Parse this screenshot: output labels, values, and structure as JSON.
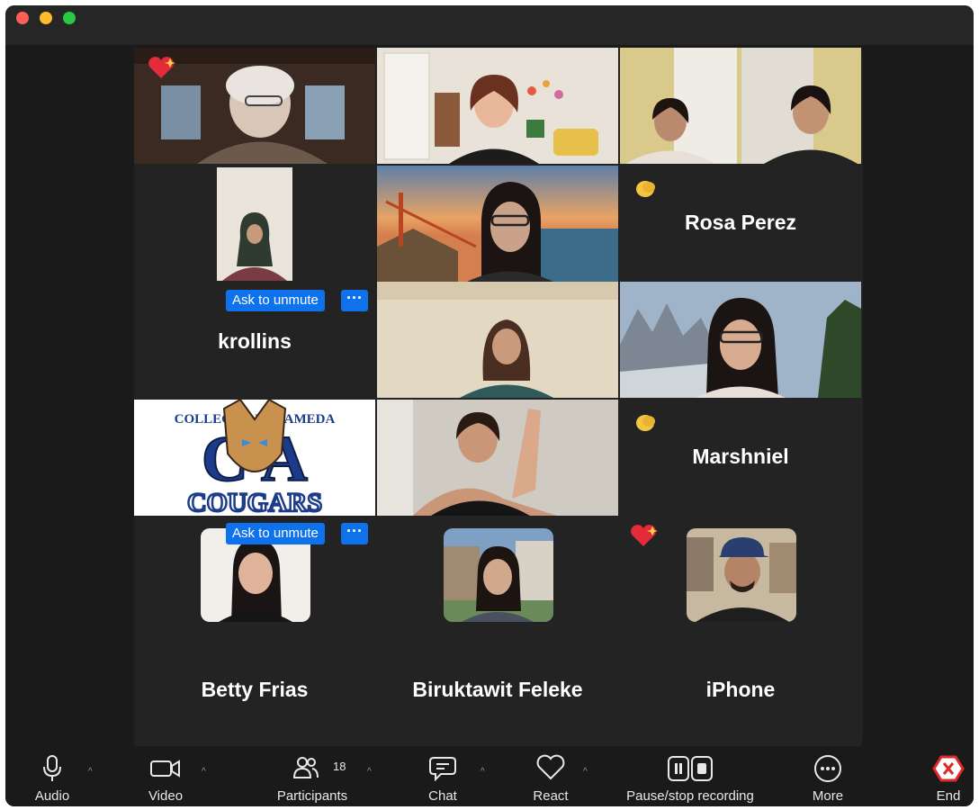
{
  "window": {
    "traffic_lights": {
      "close": "#ff5f57",
      "minimize": "#febc2e",
      "zoom": "#28c840"
    }
  },
  "gallery": {
    "accent_active_border": "#23d366",
    "unmute_button_color": "#0e72ed",
    "participants": [
      {
        "label": "video-participant-1",
        "reaction": "heart"
      },
      {
        "label": "video-participant-2-active-speaker"
      },
      {
        "label": "video-participant-3-two-people"
      },
      {
        "name": "krollins",
        "ask_unmute": "Ask to unmute",
        "more": "···"
      },
      {
        "label": "video-participant-5-golden-gate-background"
      },
      {
        "name": "Rosa Perez",
        "reaction": "clap"
      },
      {
        "label": "video-participant-7"
      },
      {
        "label": "video-participant-8-mountain-background"
      },
      {
        "label": "logo-tile",
        "logo_text_top": "COLLEGE OF ALAMEDA",
        "logo_text_mid": "C A",
        "logo_text_bottom": "COUGARS"
      },
      {
        "label": "video-participant-10-clapping"
      },
      {
        "name": "Marshniel",
        "reaction": "clap"
      },
      {
        "name": "Betty Frias",
        "ask_unmute": "Ask to unmute",
        "more": "···"
      },
      {
        "name": "Biruktawit Feleke"
      },
      {
        "name": "iPhone",
        "reaction": "heart"
      }
    ]
  },
  "toolbar": {
    "audio": "Audio",
    "video": "Video",
    "participants": "Participants",
    "participants_count": "18",
    "chat": "Chat",
    "react": "React",
    "recording": "Pause/stop recording",
    "more": "More",
    "end": "End",
    "end_color": "#e02828",
    "icons": [
      "mic-icon",
      "camera-icon",
      "people-icon",
      "chat-icon",
      "heart-outline-icon",
      "pause-stop-icon",
      "ellipsis-icon",
      "close-icon"
    ]
  }
}
